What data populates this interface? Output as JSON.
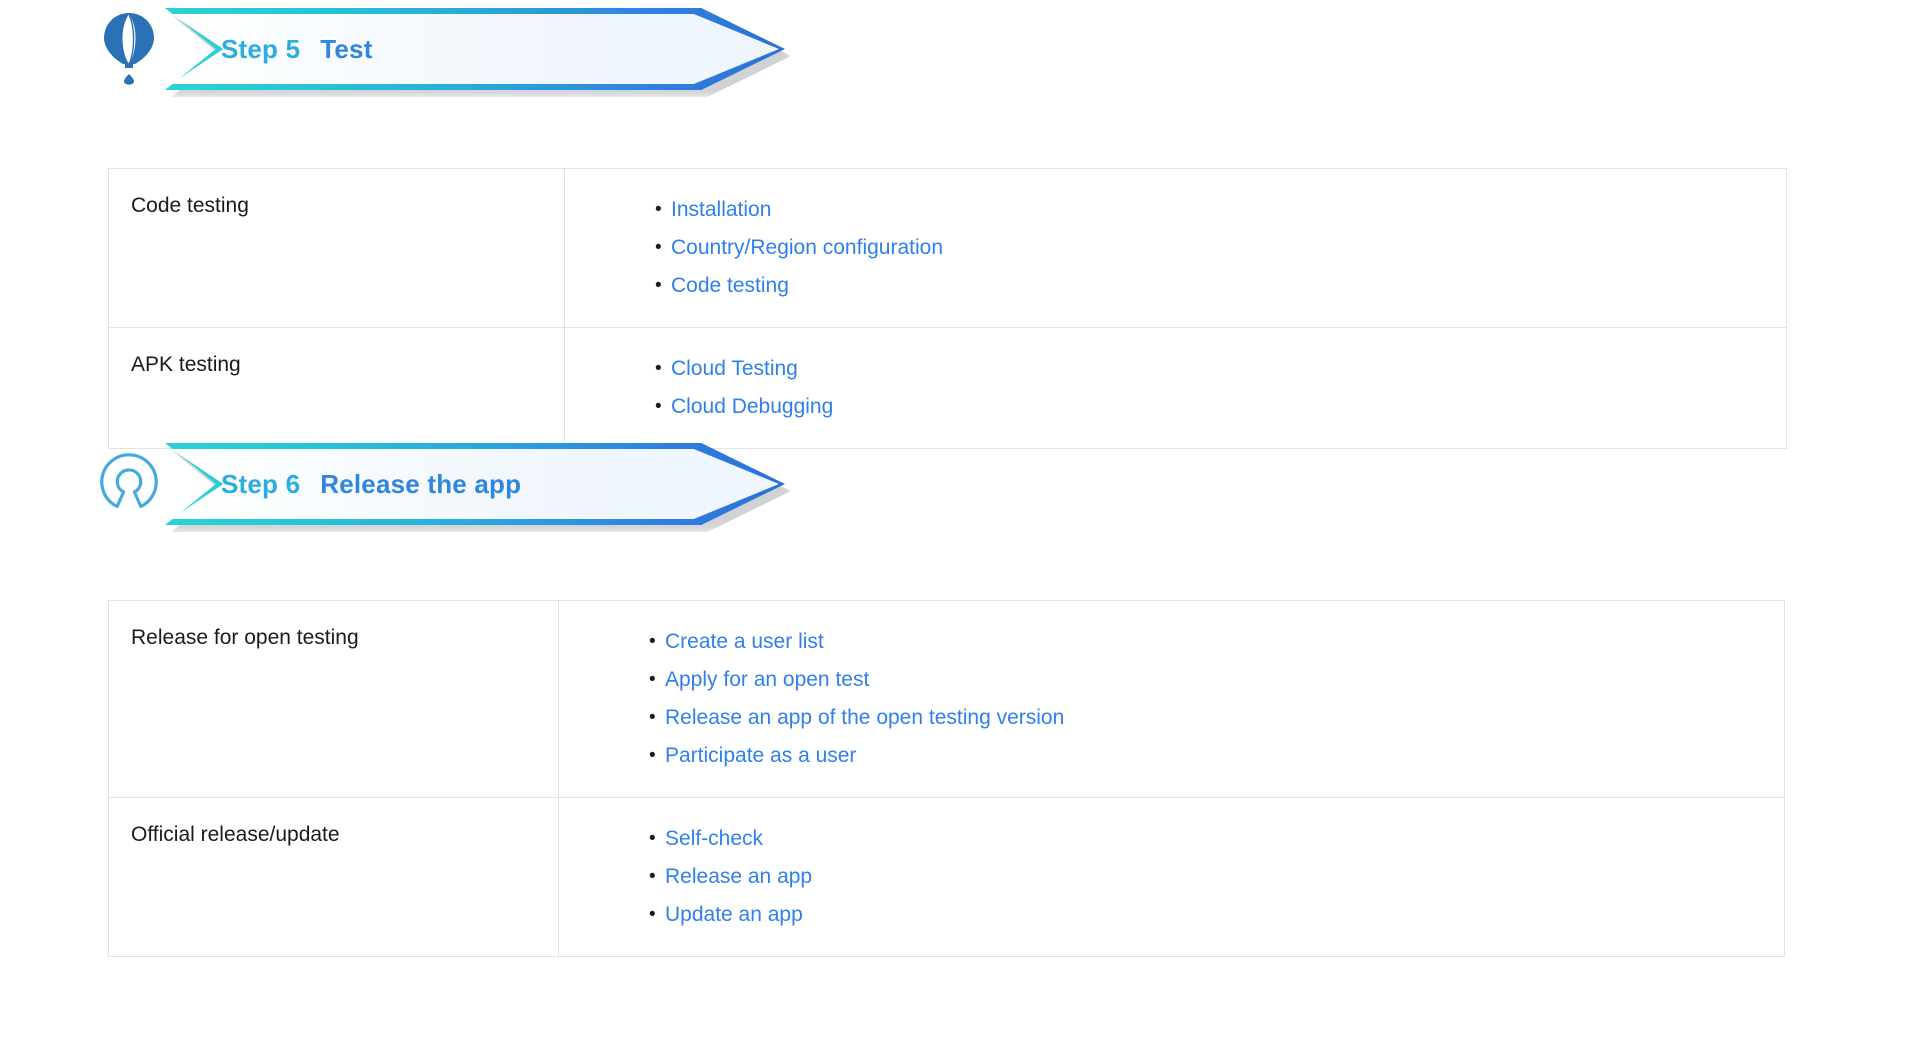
{
  "page": {
    "background": "#ffffff",
    "link_color": "#2f80ed",
    "text_color": "#1b1b1b",
    "banner_border_start": "#2ad3d6",
    "banner_border_end": "#2b6fd6",
    "table_border_color": "#e2e2e2"
  },
  "steps": [
    {
      "icon": "hot-air-balloon-icon",
      "number": "Step 5",
      "title": "Test",
      "table": {
        "rows": [
          {
            "label": "Code testing",
            "links": [
              "Installation",
              "Country/Region configuration",
              "Code testing"
            ]
          },
          {
            "label": "APK testing",
            "links": [
              "Cloud Testing",
              "Cloud Debugging"
            ]
          }
        ]
      }
    },
    {
      "icon": "open-source-initiative-icon",
      "number": "Step 6",
      "title": "Release the app",
      "table": {
        "rows": [
          {
            "label": "Release for open testing",
            "links": [
              "Create a user list",
              "Apply for an open test",
              "Release an app of the open testing version",
              "Participate as a user"
            ]
          },
          {
            "label": "Official release/update",
            "links": [
              "Self-check",
              "Release an app",
              "Update an app"
            ]
          }
        ]
      }
    }
  ]
}
